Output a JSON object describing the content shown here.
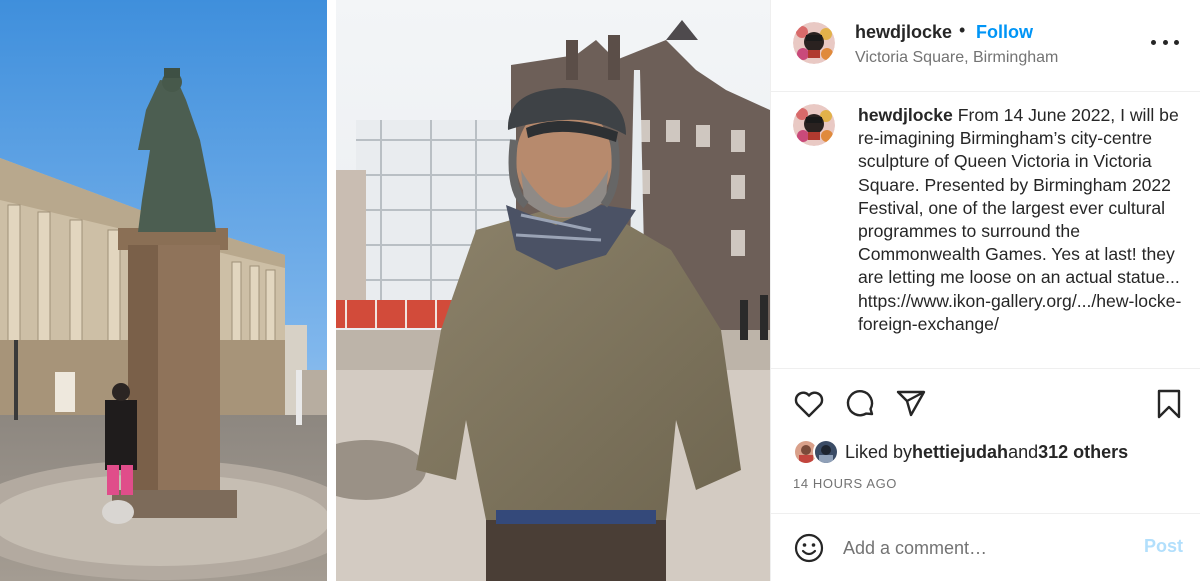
{
  "post": {
    "username": "hewdjlocke",
    "separator": "•",
    "follow_label": "Follow",
    "location": "Victoria Square, Birmingham",
    "caption_username": "hewdjlocke",
    "caption_text": " From 14 June 2022, I will be re-imagining Birmingham’s city-centre sculpture of Queen Victoria in Victoria Square. Presented by Birmingham 2022 Festival, one of the largest ever cultural programmes to surround the Commonwealth Games. Yes at last! they are letting me loose on an actual statue... https://www.ikon-gallery.org/.../hew-locke-foreign-exchange/",
    "likes": {
      "prefix": "Liked by ",
      "liker": "hettiejudah",
      "middle": " and ",
      "others": "312 others"
    },
    "timestamp": "14 HOURS AGO"
  },
  "comment": {
    "placeholder": "Add a comment…",
    "post_label": "Post"
  },
  "icons": {
    "more": "more-options-icon",
    "like": "heart-icon",
    "comment": "comment-icon",
    "share": "share-icon",
    "save": "bookmark-icon",
    "emoji": "emoji-icon"
  },
  "colors": {
    "accent": "#0095f6",
    "post_disabled": "#b2dffc",
    "secondary_text": "#737373",
    "divider": "#efefef"
  }
}
